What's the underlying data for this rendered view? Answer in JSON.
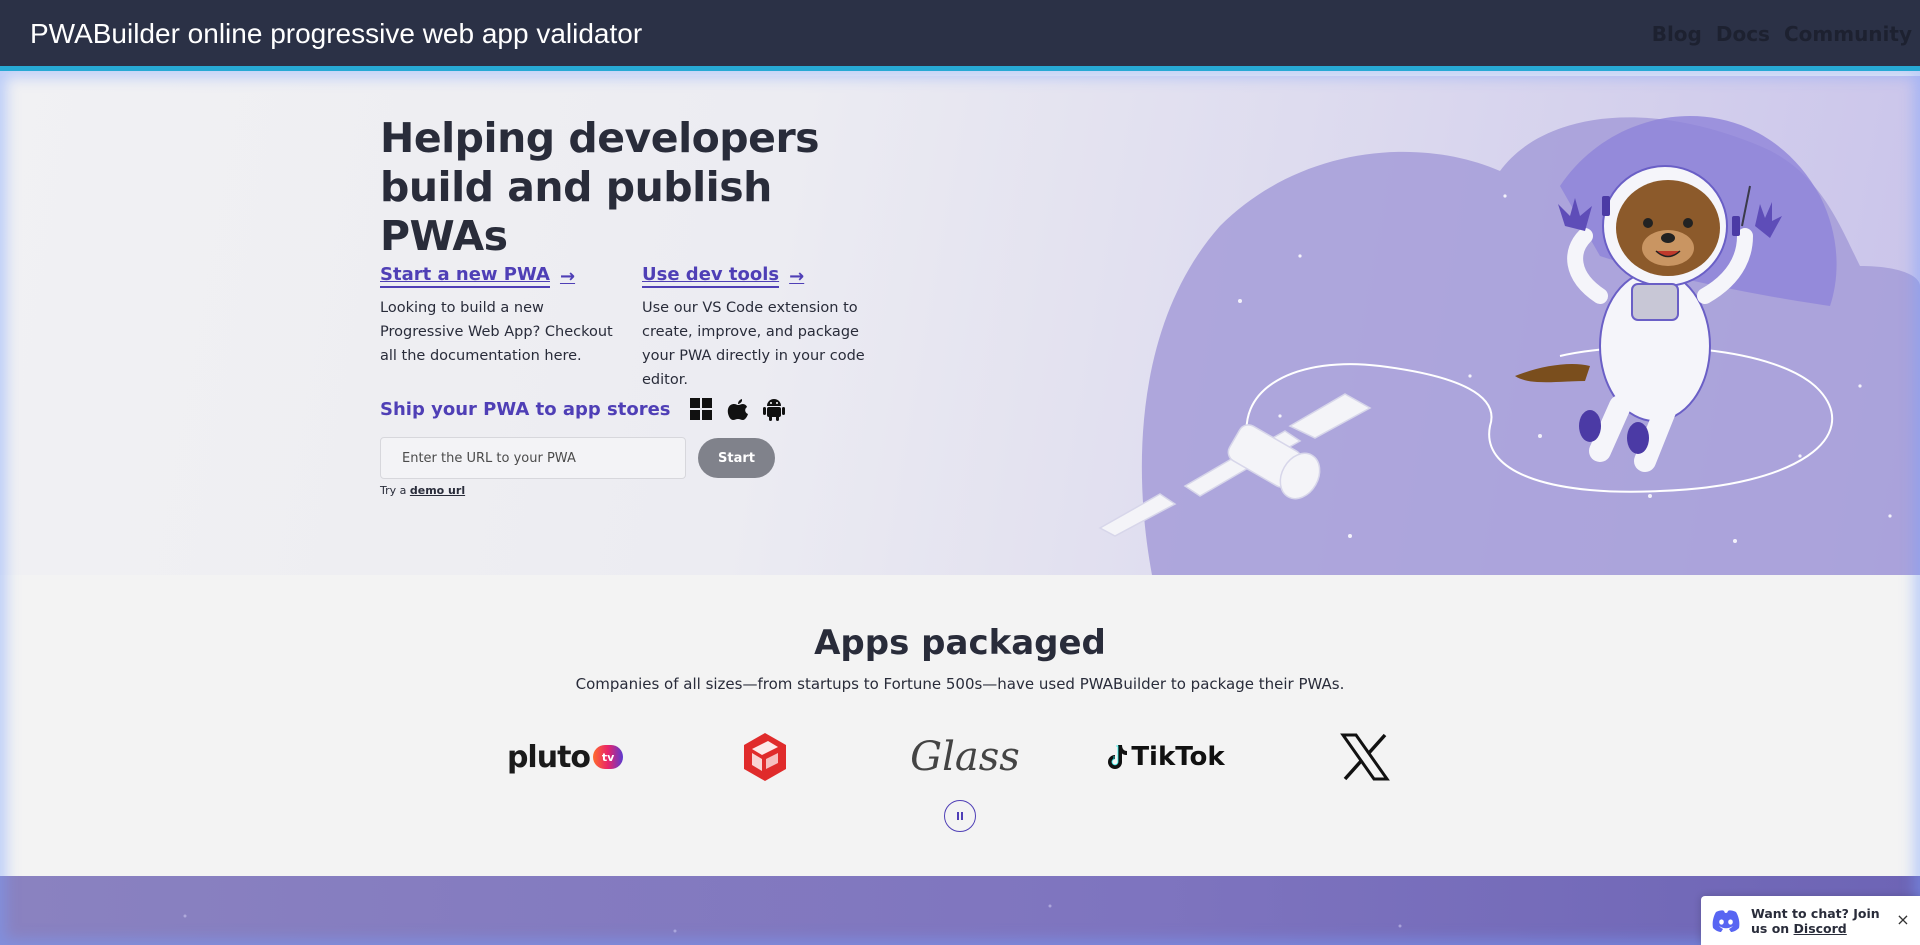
{
  "window": {
    "title": "PWABuilder online progressive web app validator"
  },
  "nav": {
    "items": [
      {
        "label": "Blog"
      },
      {
        "label": "Docs"
      },
      {
        "label": "Community"
      }
    ]
  },
  "hero": {
    "title": "Helping developers build and publish PWAs",
    "start_new": {
      "label": "Start a new PWA",
      "arrow": "→",
      "description": "Looking to build a new Progressive Web App? Checkout all the documentation here."
    },
    "dev_tools": {
      "label": "Use dev tools",
      "arrow": "→",
      "description": "Use our VS Code extension to create, improve, and package your PWA directly in your code editor."
    },
    "ship": {
      "label": "Ship your PWA to app stores",
      "icons": [
        "windows-icon",
        "apple-icon",
        "android-icon"
      ]
    },
    "url_input": {
      "placeholder": "Enter the URL to your PWA",
      "value": ""
    },
    "start_button": "Start",
    "demo": {
      "prefix": "Try a",
      "link": "demo url"
    }
  },
  "apps": {
    "title": "Apps packaged",
    "subtitle": "Companies of all sizes—from startups to Fortune 500s—have used PWABuilder to package their PWAs.",
    "logos": [
      {
        "name": "pluto-tv-logo",
        "text": "pluto",
        "badge": "tv"
      },
      {
        "name": "sketchup-logo",
        "text": ""
      },
      {
        "name": "glass-logo",
        "text": "Glass"
      },
      {
        "name": "tiktok-logo",
        "text": "TikTok"
      },
      {
        "name": "x-logo",
        "text": "X"
      }
    ],
    "pause_icon": "pause-icon"
  },
  "discord": {
    "text_prefix": "Want to chat? Join us on",
    "link": "Discord",
    "close": "×"
  },
  "colors": {
    "accent": "#4f3fb6",
    "header_bg": "#2b3146",
    "header_border": "#27a9d4",
    "start_button": "#80828b"
  }
}
